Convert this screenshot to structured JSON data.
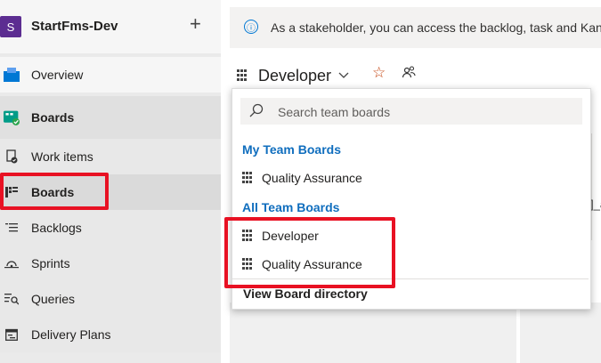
{
  "project": {
    "avatar_letter": "S",
    "name": "StartFms-Dev",
    "add_symbol": "+"
  },
  "nav": {
    "overview": "Overview",
    "boards_hub": "Boards",
    "work_items": "Work items",
    "boards": "Boards",
    "backlogs": "Backlogs",
    "sprints": "Sprints",
    "queries": "Queries",
    "delivery_plans": "Delivery Plans"
  },
  "info_bar": {
    "icon": "ⓘ",
    "text": "As a stakeholder, you can access the backlog, task and Kanban boards"
  },
  "board": {
    "title": "Developer",
    "star": "☆"
  },
  "dropdown": {
    "search_placeholder": "Search team boards",
    "my_team_boards_heading": "My Team Boards",
    "my_team_boards": [
      "Quality Assurance"
    ],
    "all_team_boards_heading": "All Team Boards",
    "all_team_boards": [
      "Developer",
      "Quality Assurance"
    ],
    "view_directory": "View Board directory"
  },
  "background_fragment": "]_a",
  "colors": {
    "accent": "#106ebe",
    "highlight": "#e81123",
    "project_avatar": "#5c2d91"
  }
}
